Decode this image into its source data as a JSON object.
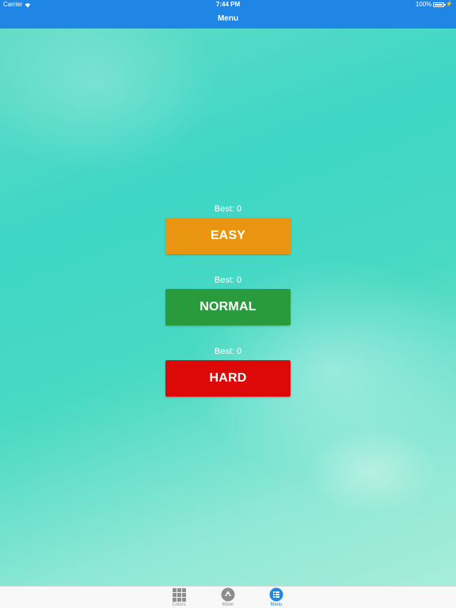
{
  "status_bar": {
    "carrier": "Carrier",
    "time": "7:44 PM",
    "battery": "100%"
  },
  "nav": {
    "title": "Menu"
  },
  "levels": [
    {
      "best": "Best: 0",
      "label": "EASY",
      "color": "#e99511"
    },
    {
      "best": "Best: 0",
      "label": "NORMAL",
      "color": "#2a9b3c"
    },
    {
      "best": "Best: 0",
      "label": "HARD",
      "color": "#dd0808"
    }
  ],
  "tab_bar": {
    "tabs": [
      {
        "label": "Colors",
        "icon": "grid-icon",
        "active": false
      },
      {
        "label": "Mixer",
        "icon": "mixer-icon",
        "active": false
      },
      {
        "label": "Menu",
        "icon": "menu-list-icon",
        "active": true
      }
    ]
  },
  "colors": {
    "nav_bar": "#1f86e6",
    "active_tab": "#1f86e6",
    "inactive_tab": "#929292"
  }
}
